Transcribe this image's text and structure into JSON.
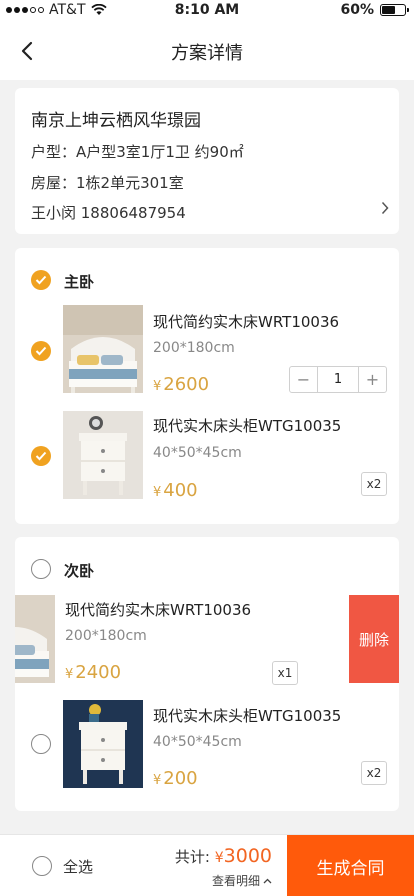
{
  "status_bar": {
    "carrier": "AT&T",
    "time": "8:10 AM",
    "battery": "60%",
    "battery_level": 0.6
  },
  "nav": {
    "title": "方案详情"
  },
  "info": {
    "community": "南京上坤云栖风华璟园",
    "layout": "户型：A户型3室1厅1卫 约90㎡",
    "house": "房屋：1栋2单元301室",
    "contact": "王小闵 18806487954"
  },
  "rooms": [
    {
      "name": "主卧",
      "checked": true,
      "items": [
        {
          "name": "现代简约实木床WRT10036",
          "size": "200*180cm",
          "price": "2600",
          "currency": "¥",
          "quantity": "1",
          "checked": true,
          "image_icon": "bed-photo"
        },
        {
          "name": "现代实木床头柜WTG10035",
          "size": "40*50*45cm",
          "price": "400",
          "currency": "¥",
          "quantity": "x2",
          "checked": true,
          "image_icon": "nightstand-photo"
        }
      ]
    },
    {
      "name": "次卧",
      "checked": false,
      "items": [
        {
          "name": "现代简约实木床WRT10036",
          "size": "200*180cm",
          "price": "2400",
          "currency": "¥",
          "quantity": "x1",
          "checked": false,
          "image_icon": "bed-photo",
          "swipe_action": "删除"
        },
        {
          "name": "现代实木床头柜WTG10035",
          "size": "40*50*45cm",
          "price": "200",
          "currency": "¥",
          "quantity": "x2",
          "checked": false,
          "image_icon": "nightstand-photo"
        }
      ]
    }
  ],
  "footer": {
    "select_all": "全选",
    "total_label": "共计:",
    "currency": "¥",
    "total_value": "3000",
    "details": "查看明细",
    "submit": "生成合同"
  },
  "colors": {
    "accent": "#f0a220",
    "price": "#d9a441",
    "primary_button": "#ff5a0b",
    "delete": "#f05743",
    "total": "#f26522"
  }
}
